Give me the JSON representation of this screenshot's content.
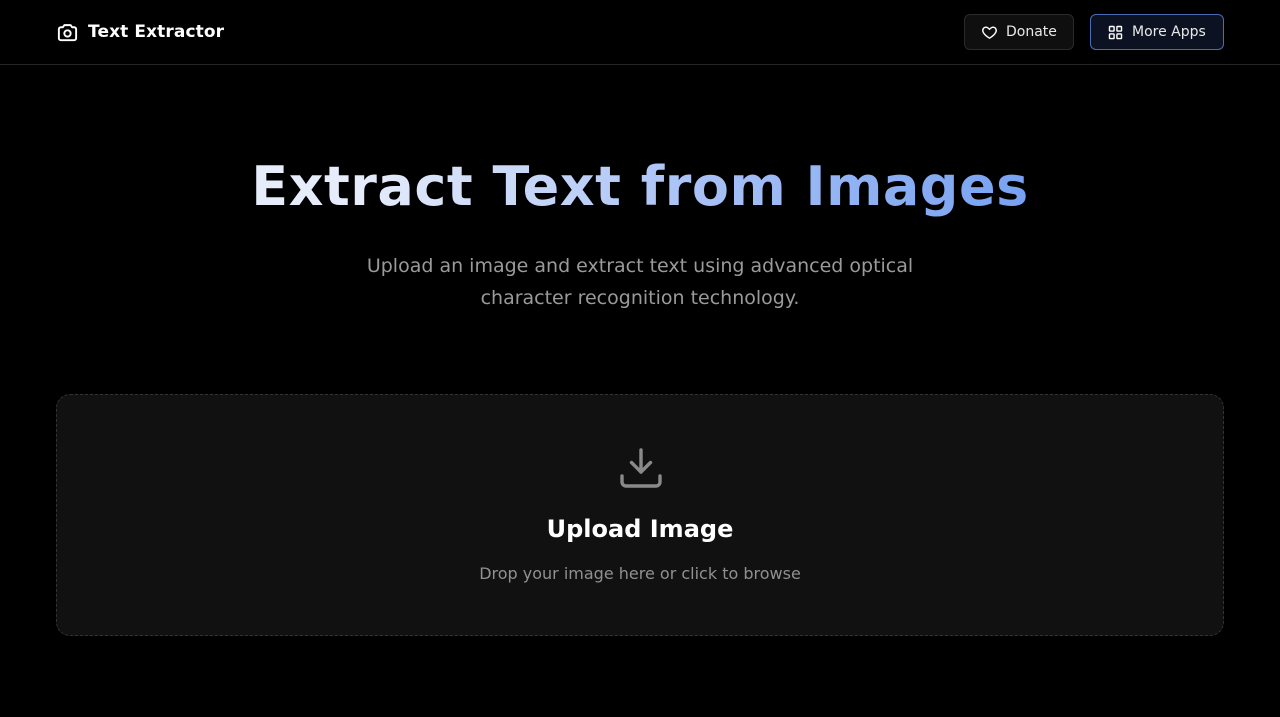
{
  "header": {
    "brand_icon": "camera-icon",
    "title": "Text Extractor",
    "donate": {
      "icon": "heart-icon",
      "label": "Donate"
    },
    "more_apps": {
      "icon": "grid-icon",
      "label": "More Apps",
      "border_color": "#4a6bb8"
    }
  },
  "hero": {
    "title": "Extract Text from Images",
    "subtitle": "Upload an image and extract text using advanced optical character recognition technology.",
    "gradient_colors": [
      "#e6ecfa",
      "#a7c0f6",
      "#6e9cf0"
    ]
  },
  "upload": {
    "icon": "download-tray-icon",
    "title": "Upload Image",
    "hint": "Drop your image here or click to browse"
  },
  "colors": {
    "background": "#000000",
    "panel": "#111111",
    "muted_text": "#909090"
  }
}
